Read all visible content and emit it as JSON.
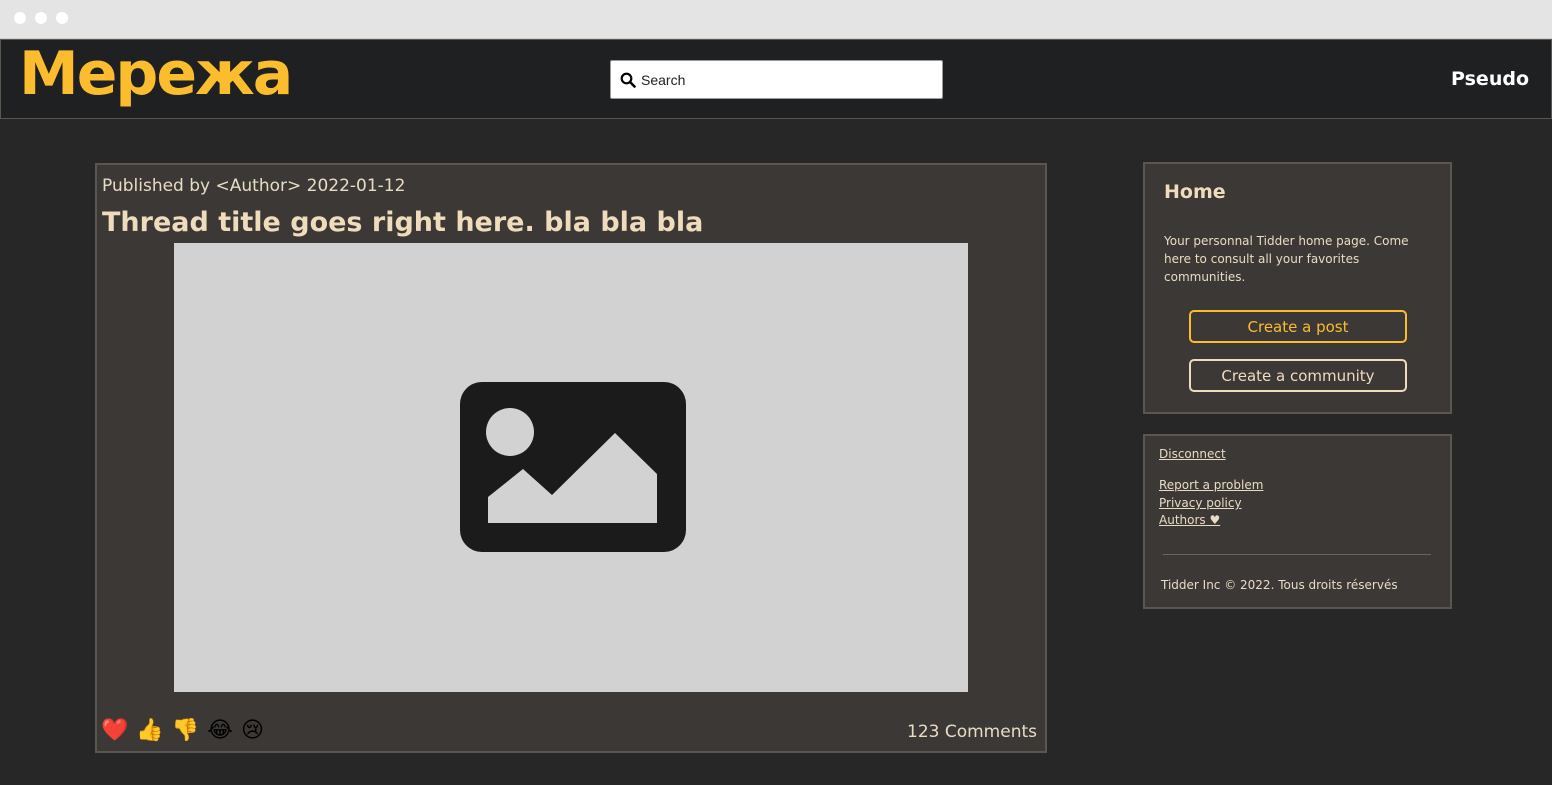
{
  "header": {
    "logo": "Мережа",
    "search_placeholder": "Search",
    "username": "Pseudo",
    "accent_color": "#fbbd2e"
  },
  "post": {
    "meta": "Published by <Author> 2022-01-12",
    "title": "Thread title goes right here. bla bla bla",
    "image_icon": "image-placeholder-icon",
    "reactions": [
      "❤️",
      "👍",
      "👎",
      "😂",
      "😢"
    ],
    "comments": "123 Comments"
  },
  "sidebar": {
    "home_title": "Home",
    "home_text": "Your personnal Tidder home page. Come here to consult all your favorites communities.",
    "create_post": "Create a post",
    "create_community": "Create a community"
  },
  "footer": {
    "links": [
      "Disconnect",
      "Report a problem",
      "Privacy policy",
      "Authors ♥"
    ],
    "copyright": "Tidder Inc © 2022. Tous droits réservés"
  }
}
